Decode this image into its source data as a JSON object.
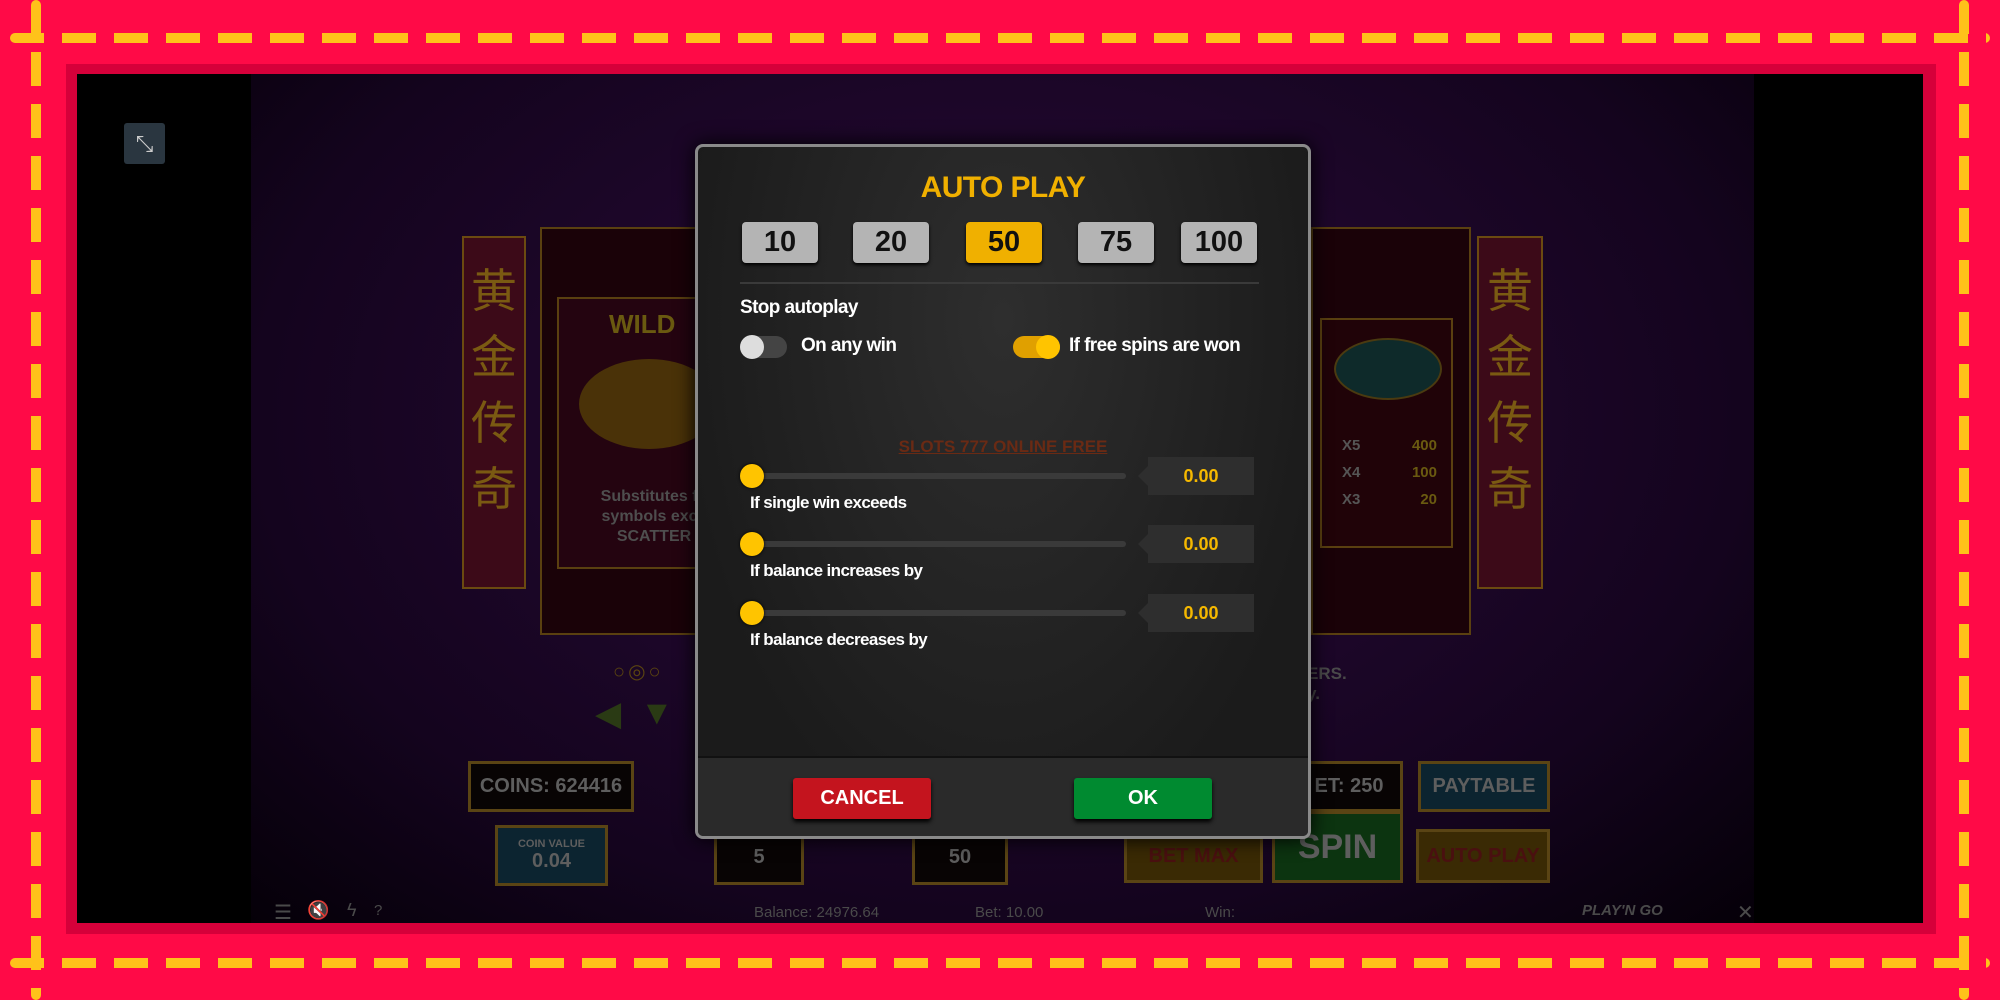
{
  "colors": {
    "border": "#ff0a47",
    "dash": "#ffc21a",
    "accent": "#f0b000",
    "cancel": "#c4141e",
    "ok": "#008a30"
  },
  "background": {
    "banner_chars": "黄金传奇",
    "wild_title": "WILD",
    "wild_text": [
      "Substitutes fo",
      "symbols exce",
      "SCATTER"
    ],
    "fish_pays": [
      {
        "k": "X5",
        "v": "400"
      },
      {
        "k": "X4",
        "v": "100"
      },
      {
        "k": "X3",
        "v": "20"
      }
    ],
    "right_text": [
      "ERS.",
      "y."
    ],
    "coins": "COINS: 624416",
    "coin_value_label": "COIN VALUE",
    "coin_value": "0.04",
    "coin_count": "5",
    "level": "50",
    "bet": "ET: 250",
    "paytable": "PAYTABLE",
    "bet_max": "BET MAX",
    "spin": "SPIN",
    "auto_play": "AUTO PLAY"
  },
  "bottom_bar": {
    "balance": "Balance: 24976.64",
    "bet": "Bet: 10.00",
    "win": "Win:",
    "logo": "PLAY'N GO",
    "help": "?"
  },
  "dialog": {
    "title": "AUTO PLAY",
    "counts": [
      {
        "label": "10",
        "selected": false
      },
      {
        "label": "20",
        "selected": false
      },
      {
        "label": "50",
        "selected": true
      },
      {
        "label": "75",
        "selected": false
      },
      {
        "label": "100",
        "selected": false
      }
    ],
    "stop_heading": "Stop autoplay",
    "toggles": [
      {
        "label": "On any win",
        "on": false
      },
      {
        "label": "If free spins are won",
        "on": true
      }
    ],
    "watermark": "SLOTS 777 ONLINE FREE",
    "sliders": [
      {
        "label": "If single win exceeds",
        "value": "0.00",
        "level": 0
      },
      {
        "label": "If balance increases by",
        "value": "0.00",
        "level": 0
      },
      {
        "label": "If balance decreases by",
        "value": "0.00",
        "level": 0
      }
    ],
    "cancel": "CANCEL",
    "ok": "OK"
  }
}
